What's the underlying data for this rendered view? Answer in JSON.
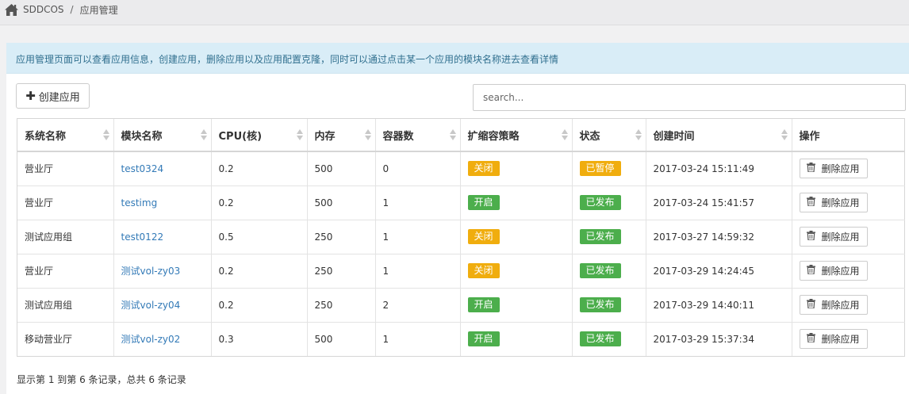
{
  "breadcrumb": {
    "home_icon": "home-icon",
    "home_label": "SDDCOS",
    "separator": "/",
    "current": "应用管理"
  },
  "info_alert": {
    "text": "应用管理页面可以查看应用信息，创建应用，删除应用以及应用配置克隆，同时可以通过点击某一个应用的模块名称进去查看详情"
  },
  "toolbar": {
    "create_icon": "plus-icon",
    "create_label": "创建应用",
    "search_placeholder": "search..."
  },
  "table": {
    "columns": [
      "系统名称",
      "模块名称",
      "CPU(核)",
      "内存",
      "容器数",
      "扩缩容策略",
      "状态",
      "创建时间",
      "操作"
    ],
    "rows": [
      {
        "system": "营业厅",
        "module": "test0324",
        "cpu": "0.2",
        "memory": "500",
        "containers": "0",
        "scaling": "关闭",
        "status": "已暂停",
        "created": "2017-03-24 15:11:49",
        "action": "删除应用"
      },
      {
        "system": "营业厅",
        "module": "testimg",
        "cpu": "0.2",
        "memory": "500",
        "containers": "1",
        "scaling": "开启",
        "status": "已发布",
        "created": "2017-03-24 15:41:57",
        "action": "删除应用"
      },
      {
        "system": "测试应用组",
        "module": "test0122",
        "cpu": "0.5",
        "memory": "250",
        "containers": "1",
        "scaling": "关闭",
        "status": "已发布",
        "created": "2017-03-27 14:59:32",
        "action": "删除应用"
      },
      {
        "system": "营业厅",
        "module": "测试vol-zy03",
        "cpu": "0.2",
        "memory": "250",
        "containers": "1",
        "scaling": "关闭",
        "status": "已发布",
        "created": "2017-03-29 14:24:45",
        "action": "删除应用"
      },
      {
        "system": "测试应用组",
        "module": "测试vol-zy04",
        "cpu": "0.2",
        "memory": "250",
        "containers": "2",
        "scaling": "开启",
        "status": "已发布",
        "created": "2017-03-29 14:40:11",
        "action": "删除应用"
      },
      {
        "system": "移动营业厅",
        "module": "测试vol-zy02",
        "cpu": "0.3",
        "memory": "500",
        "containers": "1",
        "scaling": "开启",
        "status": "已发布",
        "created": "2017-03-29 15:37:34",
        "action": "删除应用"
      }
    ]
  },
  "badge_colors": {
    "关闭": "#f0ad0e",
    "开启": "#4cae4c",
    "已暂停": "#f0ad0e",
    "已发布": "#4cae4c"
  },
  "footer": {
    "summary": "显示第 1 到第 6 条记录，总共 6 条记录"
  }
}
